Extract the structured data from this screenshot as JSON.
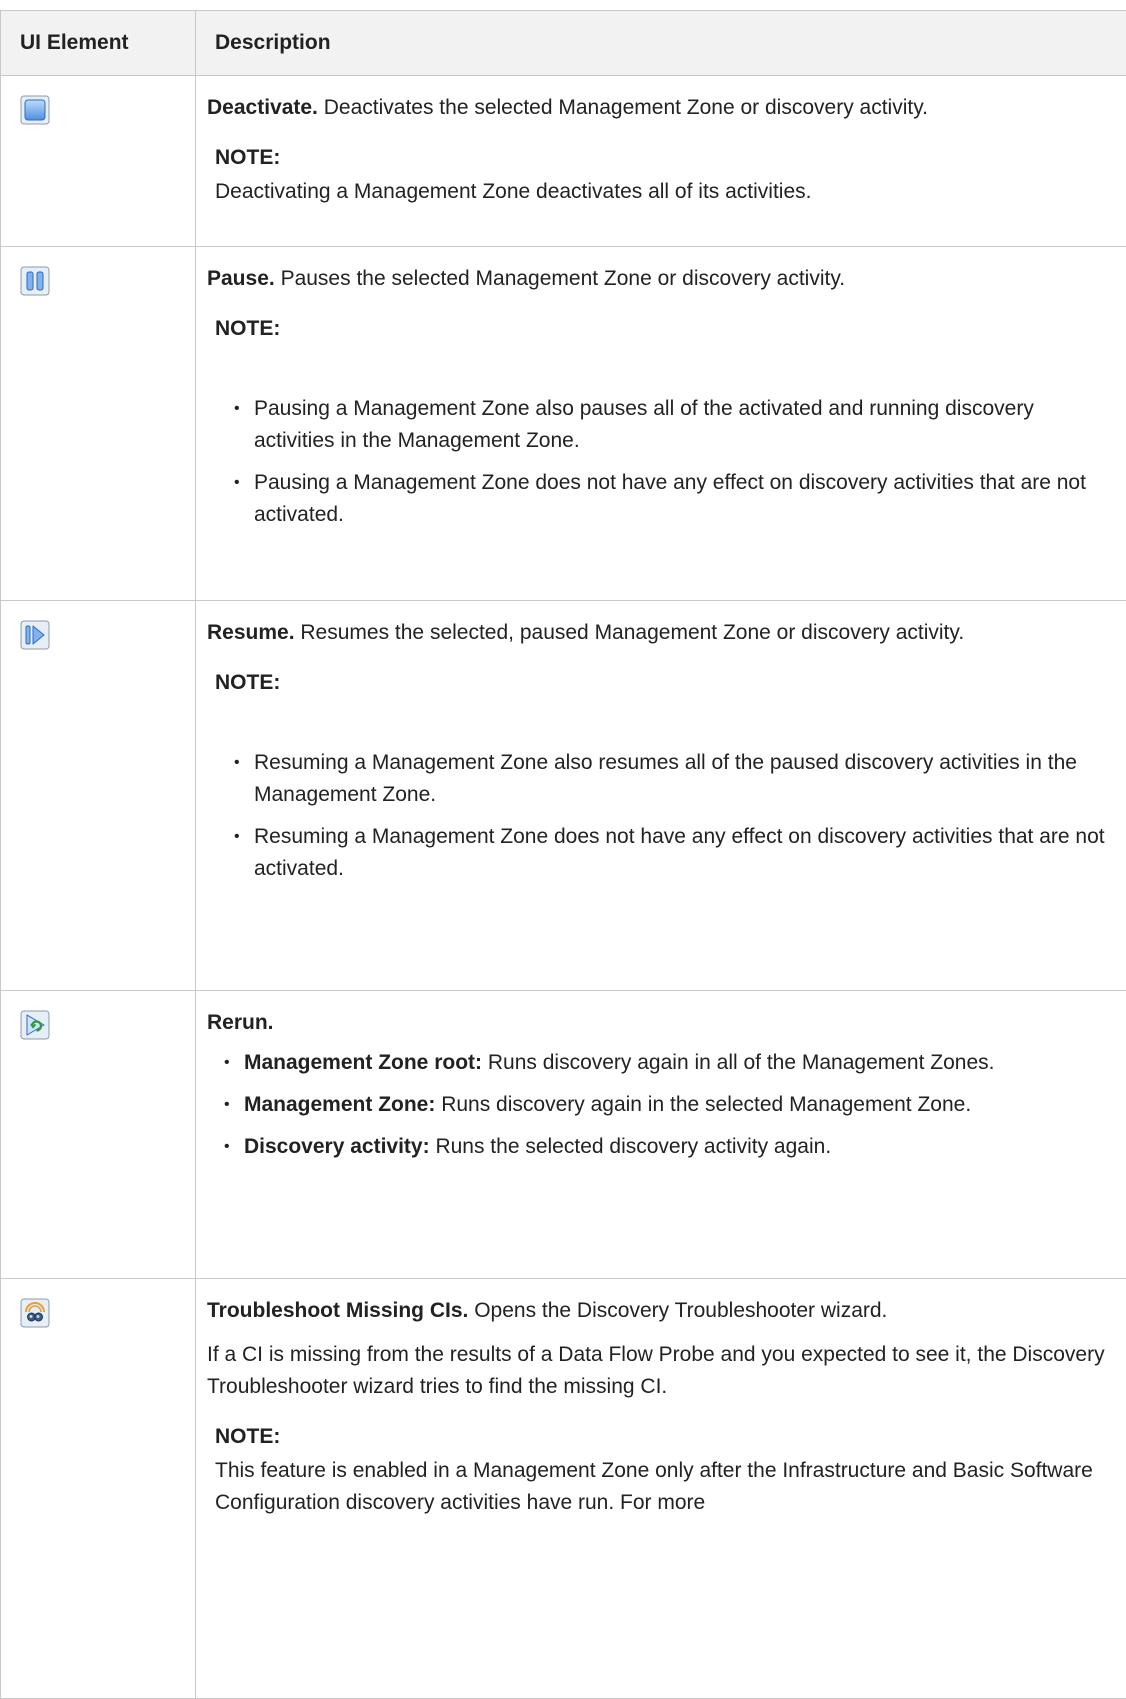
{
  "header": {
    "col1": "UI Element",
    "col2": "Description"
  },
  "rows": [
    {
      "icon": "deactivate-icon",
      "title": "Deactivate.",
      "text": "Deactivates the selected Management Zone or discovery activity.",
      "note_label": "NOTE:",
      "note_text": "Deactivating a Management Zone deactivates all of its activities."
    },
    {
      "icon": "pause-icon",
      "title": "Pause.",
      "text": "Pauses the selected Management Zone or discovery activity.",
      "note_label": "NOTE:",
      "bullets": [
        "Pausing a Management Zone also pauses all of the activated and running discovery activities in the Management Zone.",
        "Pausing a Management Zone does not have any effect on discovery activities that are not activated."
      ]
    },
    {
      "icon": "resume-icon",
      "title": "Resume.",
      "text": "Resumes the selected, paused Management Zone or discovery activity.",
      "note_label": "NOTE:",
      "bullets": [
        "Resuming a Management Zone also resumes all of the paused discovery activities in the Management Zone.",
        "Resuming a Management Zone does not have any effect on discovery activities that are not activated."
      ]
    },
    {
      "icon": "rerun-icon",
      "title": "Rerun.",
      "bullets": [
        {
          "term": "Management Zone root:",
          "text": "Runs discovery again in all of the Management Zones."
        },
        {
          "term": "Management Zone:",
          "text": "Runs discovery again in the selected Management Zone."
        },
        {
          "term": "Discovery activity:",
          "text": "Runs the selected discovery activity again."
        }
      ]
    },
    {
      "icon": "troubleshoot-icon",
      "title": "Troubleshoot Missing CIs.",
      "text": "Opens the Discovery Troubleshooter wizard.",
      "para": "If a CI is missing from the results of a Data Flow Probe and you expected to see it, the Discovery Troubleshooter wizard tries to find the missing CI.",
      "note_label": "NOTE:",
      "note_text": "This feature is enabled in a Management Zone only after the Infrastructure and Basic Software Configuration discovery activities have run. For more"
    }
  ]
}
